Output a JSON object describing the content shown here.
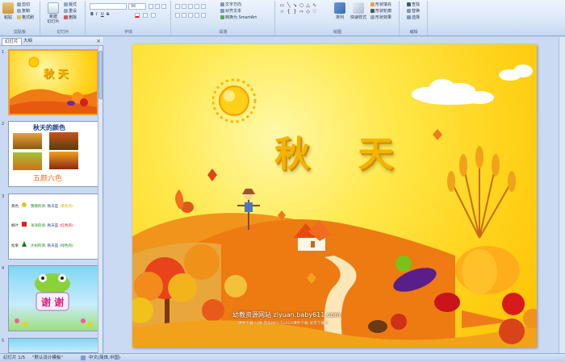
{
  "ribbon": {
    "clipboard": {
      "paste": "粘贴",
      "cut": "剪切",
      "copy": "复制",
      "format_painter": "格式刷",
      "label": "剪贴板"
    },
    "slides": {
      "new_slide": "新建\n幻灯片",
      "layout": "版式",
      "reset": "重设",
      "delete": "删除",
      "label": "幻灯片"
    },
    "font": {
      "font_size": "96",
      "bold": "B",
      "italic": "I",
      "underline": "U",
      "strikethrough": "S",
      "label": "字体"
    },
    "paragraph": {
      "text_direction": "文字方向",
      "align_text": "对齐文本",
      "smartart": "转换为 SmartArt",
      "label": "段落"
    },
    "drawing": {
      "arrange": "排列",
      "quick_styles": "快速样式",
      "shape_fill": "形状填充",
      "shape_outline": "形状轮廓",
      "shape_effects": "形状效果",
      "label": "绘图"
    },
    "editing": {
      "find": "查找",
      "replace": "替换",
      "select": "选择",
      "label": "编辑"
    }
  },
  "left_pane": {
    "tabs": [
      "幻灯片",
      "大纲"
    ],
    "close": "×",
    "thumbs": [
      {
        "num": "1",
        "title": "秋 天"
      },
      {
        "num": "2",
        "title": "秋天的颜色",
        "caption": "五颜六色"
      },
      {
        "num": "3",
        "rows": [
          {
            "k": "黄色",
            "a": "猜猜的诗,",
            "b": "秋天是",
            "c": "(黄色的)"
          },
          {
            "k": "枫叶",
            "a": "洋洋的诗,",
            "b": "秋天是",
            "c": "(红色的)"
          },
          {
            "k": "松果",
            "a": "大树的诗,",
            "b": "秋天是",
            "c": "(绿色的)"
          }
        ]
      },
      {
        "num": "4",
        "text": "谢 谢"
      },
      {
        "num": "5"
      }
    ]
  },
  "slide": {
    "title": "秋 天",
    "footer_line1": "幼教资源网站 ziyuan.baby611.com",
    "footer_line2": "课件下载  儿歌  音乐MP3  FLASH课件下载  试卷下载网"
  },
  "status": {
    "slide_count": "幻灯片 1/5",
    "theme": "\"默认设计模板\"",
    "language": "中文(简体,中国)"
  },
  "colors": {
    "accent": "#f2b400",
    "ribbon": "#d6e4f7",
    "selection": "#f0a030"
  }
}
